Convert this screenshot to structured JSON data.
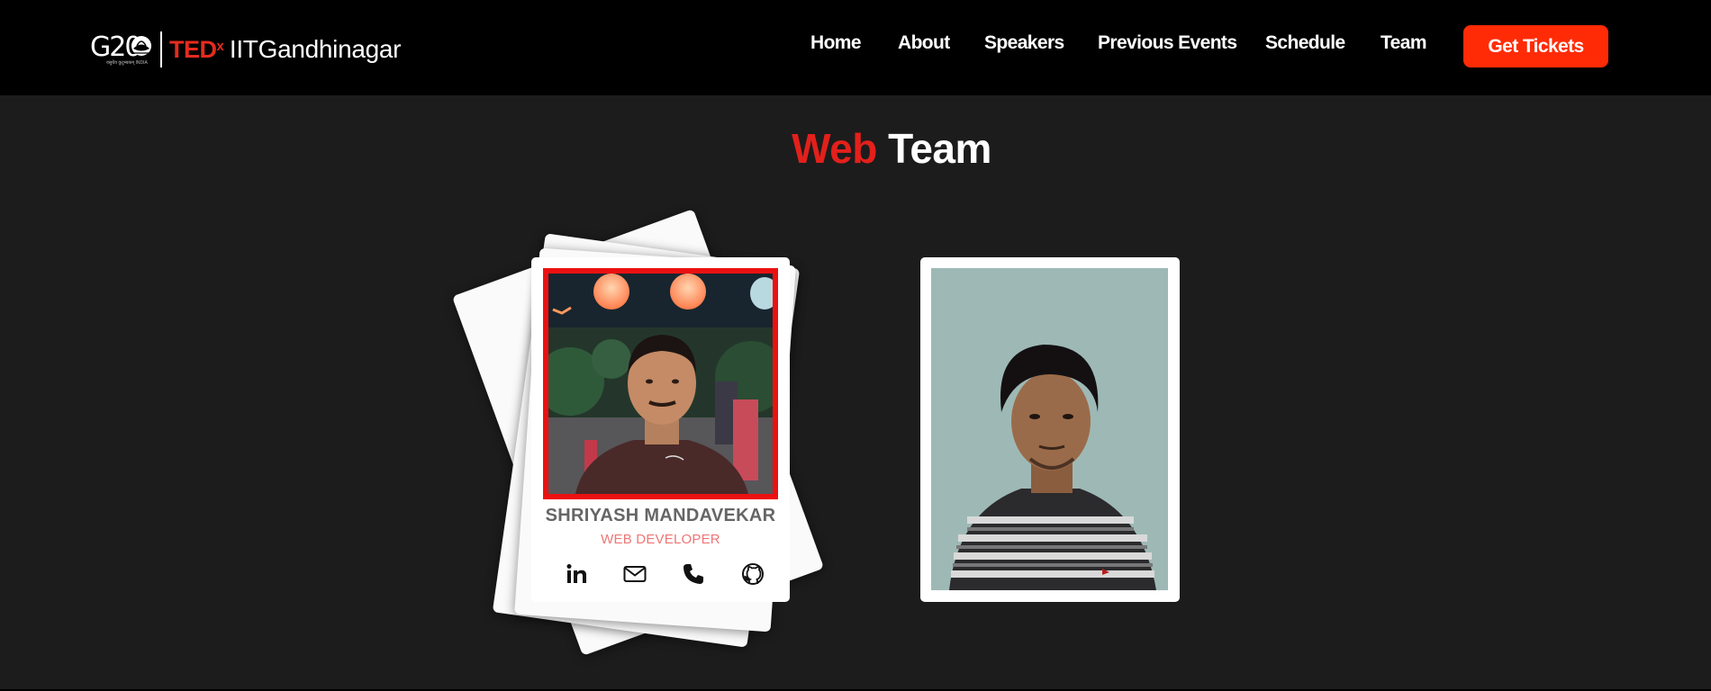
{
  "brand": {
    "g20_text": "G20",
    "g20_sub": "वसुधैव कुटुम्बकम् INDIA",
    "ted": "TED",
    "ted_x": "x",
    "name": "IITGandhinagar"
  },
  "nav": {
    "items": [
      {
        "label": "Home"
      },
      {
        "label": "About"
      },
      {
        "label": "Speakers"
      },
      {
        "label": "Previous Events"
      },
      {
        "label": "Schedule"
      },
      {
        "label": "Team"
      }
    ],
    "cta": "Get Tickets"
  },
  "section": {
    "title_red": "Web",
    "title_white": "Team"
  },
  "members": [
    {
      "name": "SHRIYASH MANDAVEKAR",
      "role": "WEB DEVELOPER",
      "icons": [
        "linkedin-icon",
        "mail-icon",
        "phone-icon",
        "github-icon"
      ]
    },
    {
      "name": "",
      "role": ""
    }
  ],
  "colors": {
    "accent": "#ff2b06",
    "title_red": "#e3201b",
    "photo_border": "#ec1111",
    "role_text": "#f07575",
    "background": "#1c1c1c",
    "header": "#000000"
  }
}
